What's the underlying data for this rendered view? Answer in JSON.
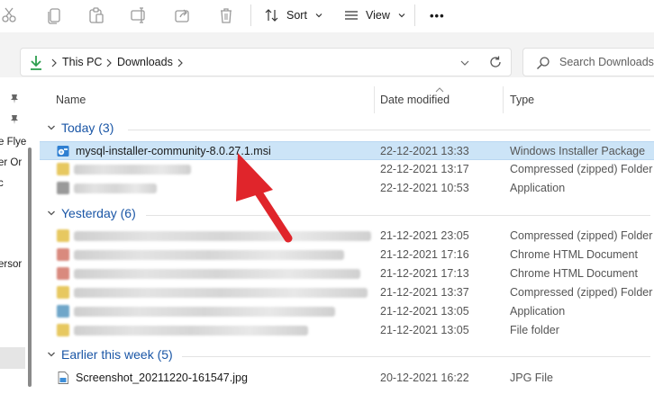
{
  "toolbar": {
    "sort_label": "Sort",
    "view_label": "View",
    "more_label": "•••"
  },
  "address": {
    "crumbs": [
      "This PC",
      "Downloads"
    ],
    "search_placeholder": "Search Downloads"
  },
  "nav": {
    "fragments": [
      "e Flye",
      "er Or",
      "c",
      "ersor"
    ]
  },
  "columns": {
    "name": "Name",
    "date": "Date modified",
    "type": "Type"
  },
  "groups": [
    {
      "label": "Today (3)",
      "rows": [
        {
          "name": "mysql-installer-community-8.0.27.1.msi",
          "date": "22-12-2021 13:33",
          "type": "Windows Installer Package"
        },
        {
          "name": "",
          "date": "22-12-2021 13:17",
          "type": "Compressed (zipped) Folder"
        },
        {
          "name": "",
          "date": "22-12-2021 10:53",
          "type": "Application"
        }
      ]
    },
    {
      "label": "Yesterday (6)",
      "rows": [
        {
          "name": "",
          "date": "21-12-2021 23:05",
          "type": "Compressed (zipped) Folder"
        },
        {
          "name": "",
          "date": "21-12-2021 17:16",
          "type": "Chrome HTML Document"
        },
        {
          "name": "",
          "date": "21-12-2021 17:13",
          "type": "Chrome HTML Document"
        },
        {
          "name": "",
          "date": "21-12-2021 13:37",
          "type": "Compressed (zipped) Folder"
        },
        {
          "name": "",
          "date": "21-12-2021 13:05",
          "type": "Application"
        },
        {
          "name": "",
          "date": "21-12-2021 13:05",
          "type": "File folder"
        }
      ]
    },
    {
      "label": "Earlier this week (5)",
      "rows": [
        {
          "name": "Screenshot_20211220-161547.jpg",
          "date": "20-12-2021 16:22",
          "type": "JPG File"
        }
      ]
    }
  ],
  "colors": {
    "accent": "#1a56a6",
    "selection": "#cce4f7",
    "annotation_arrow": "#e0252b",
    "download_icon": "#2e9e4f"
  }
}
